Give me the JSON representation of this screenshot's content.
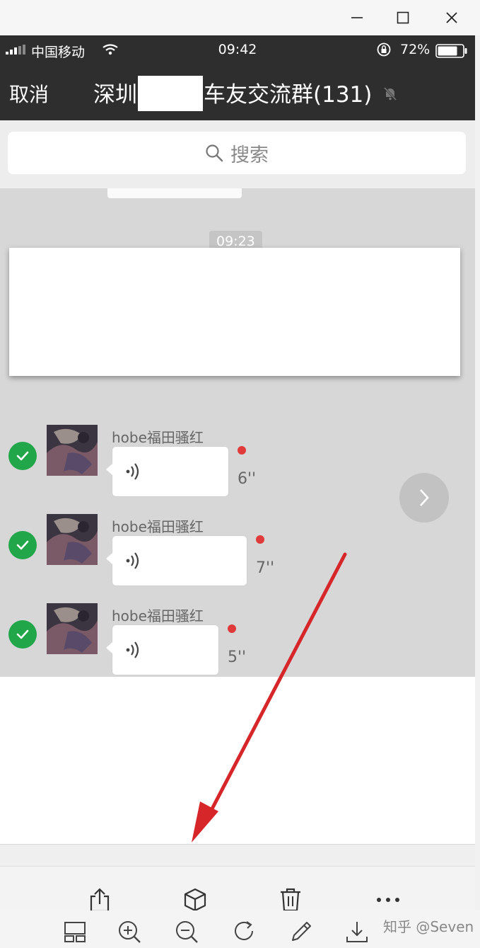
{
  "status_bar": {
    "carrier": "中国移动",
    "time": "09:42",
    "battery": "72%"
  },
  "nav": {
    "cancel_label": "取消",
    "title_prefix": "深圳",
    "title_suffix": "车友交流群(131)"
  },
  "search": {
    "placeholder": "搜索"
  },
  "chat": {
    "timestamp": "09:23",
    "messages": [
      {
        "sender": "hobe福田骚红",
        "duration": "6''"
      },
      {
        "sender": "hobe福田骚红",
        "duration": "7''"
      },
      {
        "sender": "hobe福田骚红",
        "duration": "5''"
      }
    ]
  },
  "actions": {
    "items": [
      "share-icon",
      "cube-icon",
      "trash-icon",
      "more-icon"
    ]
  },
  "viewer_toolbar": {
    "items": [
      "thumbnail-icon",
      "zoom-in-icon",
      "zoom-out-icon",
      "rotate-icon",
      "edit-icon",
      "download-icon"
    ]
  },
  "watermark": "知乎 @Seven",
  "colors": {
    "header_bg": "#2e2e2e",
    "check_green": "#22a64a",
    "unread_red": "#e03a3a",
    "arrow_red": "#d6262a"
  }
}
